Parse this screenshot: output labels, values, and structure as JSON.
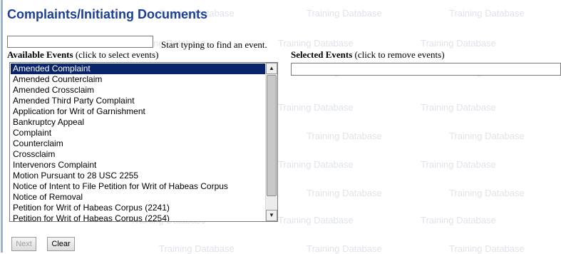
{
  "page": {
    "title": "Complaints/Initiating Documents"
  },
  "watermark": {
    "text": "Training Database"
  },
  "search": {
    "placeholder": "",
    "hint": "Start typing to find an event."
  },
  "available": {
    "label_bold": "Available Events",
    "label_rest": " (click to select events)",
    "items": [
      "Amended Complaint",
      "Amended Counterclaim",
      "Amended Crossclaim",
      "Amended Third Party Complaint",
      "Application for Writ of Garnishment",
      "Bankruptcy Appeal",
      "Complaint",
      "Counterclaim",
      "Crossclaim",
      "Intervenors Complaint",
      "Motion Pursuant to 28 USC 2255",
      "Notice of Intent to File Petition for Writ of Habeas Corpus",
      "Notice of Removal",
      "Petition for Writ of Habeas Corpus (2241)",
      "Petition for Writ of Habeas Corpus (2254)"
    ],
    "selected_index": 0
  },
  "selected": {
    "label_bold": "Selected Events",
    "label_rest": " (click to remove events)"
  },
  "buttons": {
    "next": "Next",
    "clear": "Clear"
  },
  "colors": {
    "title": "#1c3f95",
    "selection": "#0a246a",
    "watermark": "#dfe4ea"
  },
  "icons": {
    "scroll_up": "▲",
    "scroll_down": "▼"
  }
}
